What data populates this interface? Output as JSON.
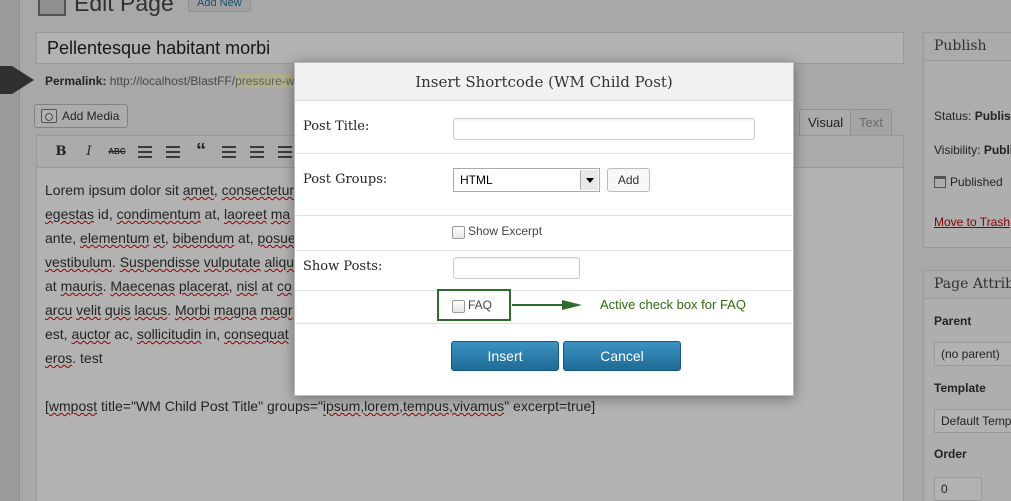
{
  "heading": {
    "title": "Edit Page",
    "add_new": "Add New"
  },
  "editor": {
    "post_title": "Pellentesque habitant morbi",
    "permalink_label": "Permalink:",
    "permalink_url": "http://localhost/BlastFF/",
    "permalink_slug": "pressure-w",
    "add_media": "Add Media",
    "tab_visual": "Visual",
    "tab_text": "Text",
    "toolbar": {
      "bold": "B",
      "italic": "I",
      "strike": "ABC",
      "quote": "“"
    },
    "content_lines": [
      [
        {
          "t": "Lorem ipsum",
          "w": false
        },
        {
          "t": " dolor sit ",
          "w": false
        },
        {
          "t": "amet",
          "w": true
        },
        {
          "t": ", ",
          "w": false
        },
        {
          "t": "consectetur",
          "w": true
        }
      ],
      [
        {
          "t": "egestas",
          "w": true
        },
        {
          "t": " id, ",
          "w": false
        },
        {
          "t": "condimentum",
          "w": true
        },
        {
          "t": " at, ",
          "w": false
        },
        {
          "t": "laoreet",
          "w": true
        },
        {
          "t": " ",
          "w": false
        },
        {
          "t": "ma",
          "w": true
        }
      ],
      [
        {
          "t": "ante",
          "w": false
        },
        {
          "t": ", ",
          "w": false
        },
        {
          "t": "elementum",
          "w": true
        },
        {
          "t": " ",
          "w": false
        },
        {
          "t": "et",
          "w": true
        },
        {
          "t": ", ",
          "w": false
        },
        {
          "t": "bibendum",
          "w": true
        },
        {
          "t": " at, ",
          "w": false
        },
        {
          "t": "posue",
          "w": true
        }
      ],
      [
        {
          "t": "vestibulum",
          "w": true
        },
        {
          "t": ". ",
          "w": false
        },
        {
          "t": "Suspendisse",
          "w": true
        },
        {
          "t": " ",
          "w": false
        },
        {
          "t": "vulputate",
          "w": true
        },
        {
          "t": " ",
          "w": false
        },
        {
          "t": "aliqu",
          "w": true
        }
      ],
      [
        {
          "t": "at ",
          "w": false
        },
        {
          "t": "mauris",
          "w": true
        },
        {
          "t": ". ",
          "w": false
        },
        {
          "t": "Maecenas",
          "w": true
        },
        {
          "t": " ",
          "w": false
        },
        {
          "t": "placerat",
          "w": true
        },
        {
          "t": ", ",
          "w": false
        },
        {
          "t": "nisl",
          "w": true
        },
        {
          "t": " at ",
          "w": false
        },
        {
          "t": "co",
          "w": true
        }
      ],
      [
        {
          "t": "arcu",
          "w": true
        },
        {
          "t": " ",
          "w": false
        },
        {
          "t": "velit",
          "w": true
        },
        {
          "t": " ",
          "w": false
        },
        {
          "t": "quis",
          "w": true
        },
        {
          "t": " ",
          "w": false
        },
        {
          "t": "lacus",
          "w": true
        },
        {
          "t": ". ",
          "w": false
        },
        {
          "t": "Morbi",
          "w": true
        },
        {
          "t": " ",
          "w": false
        },
        {
          "t": "magna",
          "w": true
        },
        {
          "t": " ",
          "w": false
        },
        {
          "t": "magr",
          "w": true
        }
      ],
      [
        {
          "t": "est, ",
          "w": false
        },
        {
          "t": "auctor",
          "w": true
        },
        {
          "t": " ac, ",
          "w": false
        },
        {
          "t": "sollicitudin",
          "w": true
        },
        {
          "t": " in, ",
          "w": false
        },
        {
          "t": "consequat",
          "w": true
        }
      ],
      [
        {
          "t": "eros",
          "w": true
        },
        {
          "t": ". test",
          "w": false
        }
      ]
    ],
    "shortcode_line": [
      {
        "t": "[",
        "w": false
      },
      {
        "t": "wmpost",
        "w": true
      },
      {
        "t": " title=\"WM Child Post Title\" groups=\"",
        "w": false
      },
      {
        "t": "ipsum,lorem,tempus,vivamus",
        "w": true
      },
      {
        "t": "\" excerpt=true]",
        "w": false
      }
    ]
  },
  "sidebar": {
    "publish_title": "Publish",
    "status_label": "Status:",
    "status_value": "Publis",
    "visibility_label": "Visibility:",
    "visibility_value": "Publi",
    "published_text": "Published",
    "trash_link": "Move to Trash",
    "attributes_title": "Page Attribu",
    "parent_label": "Parent",
    "parent_value": "(no parent)",
    "template_label": "Template",
    "template_value": "Default Temp",
    "order_label": "Order",
    "order_value": "0"
  },
  "modal": {
    "title": "Insert Shortcode (WM Child Post)",
    "post_title_label": "Post Title:",
    "post_title_value": "",
    "post_groups_label": "Post Groups:",
    "post_groups_selected": "HTML",
    "add_button": "Add",
    "show_excerpt_label": "Show Excerpt",
    "show_posts_label": "Show Posts:",
    "show_posts_value": "",
    "faq_label": "FAQ",
    "insert_button": "Insert",
    "cancel_button": "Cancel"
  },
  "annotation": {
    "text": "Active check box for FAQ",
    "color": "#2e6b2e"
  },
  "colors": {
    "primary_button": "#2a83b4",
    "trash_link": "#bc0b0b",
    "overlay": "rgba(0,0,0,0.30)"
  }
}
